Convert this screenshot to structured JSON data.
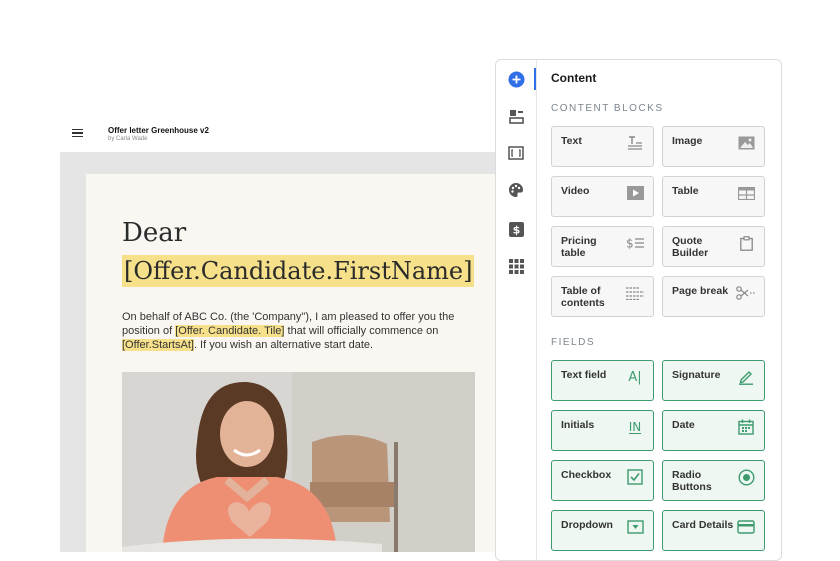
{
  "document": {
    "title": "Offer letter Greenhouse v2",
    "author": "by Carla Wade",
    "greeting": "Dear",
    "greeting_variable": "[Offer.Candidate.FirstName]",
    "body_part1": "On behalf of ABC Co. (the 'Company\"), I am pleased to offer you the position of ",
    "body_var1": "[Offer. Candidate. Tile]",
    "body_part2": " that will officially commence on ",
    "body_var2": "[Offer.StartsAt]",
    "body_part3": ". If you wish an alternative start date."
  },
  "panel": {
    "title": "Content",
    "content_blocks_label": "CONTENT BLOCKS",
    "fields_label": "FIELDS",
    "content_blocks": [
      {
        "label": "Text",
        "icon": "text-icon"
      },
      {
        "label": "Image",
        "icon": "image-icon"
      },
      {
        "label": "Video",
        "icon": "video-icon"
      },
      {
        "label": "Table",
        "icon": "table-icon"
      },
      {
        "label": "Pricing table",
        "icon": "pricing-table-icon"
      },
      {
        "label": "Quote Builder",
        "icon": "quote-builder-icon"
      },
      {
        "label": "Table of contents",
        "icon": "table-of-contents-icon"
      },
      {
        "label": "Page break",
        "icon": "scissors-icon"
      }
    ],
    "fields": [
      {
        "label": "Text field",
        "icon": "text-field-icon"
      },
      {
        "label": "Signature",
        "icon": "signature-icon"
      },
      {
        "label": "Initials",
        "icon": "initials-icon"
      },
      {
        "label": "Date",
        "icon": "calendar-icon"
      },
      {
        "label": "Checkbox",
        "icon": "checkbox-icon"
      },
      {
        "label": "Radio Buttons",
        "icon": "radio-icon"
      },
      {
        "label": "Dropdown",
        "icon": "dropdown-icon"
      },
      {
        "label": "Card Details",
        "icon": "card-icon"
      }
    ]
  },
  "icon_glyphs": {
    "initials": "IN",
    "text_field": "A|"
  },
  "colors": {
    "accent": "#2f6fe8",
    "field_green": "#3d9b6f",
    "highlight": "#f6e08a"
  }
}
